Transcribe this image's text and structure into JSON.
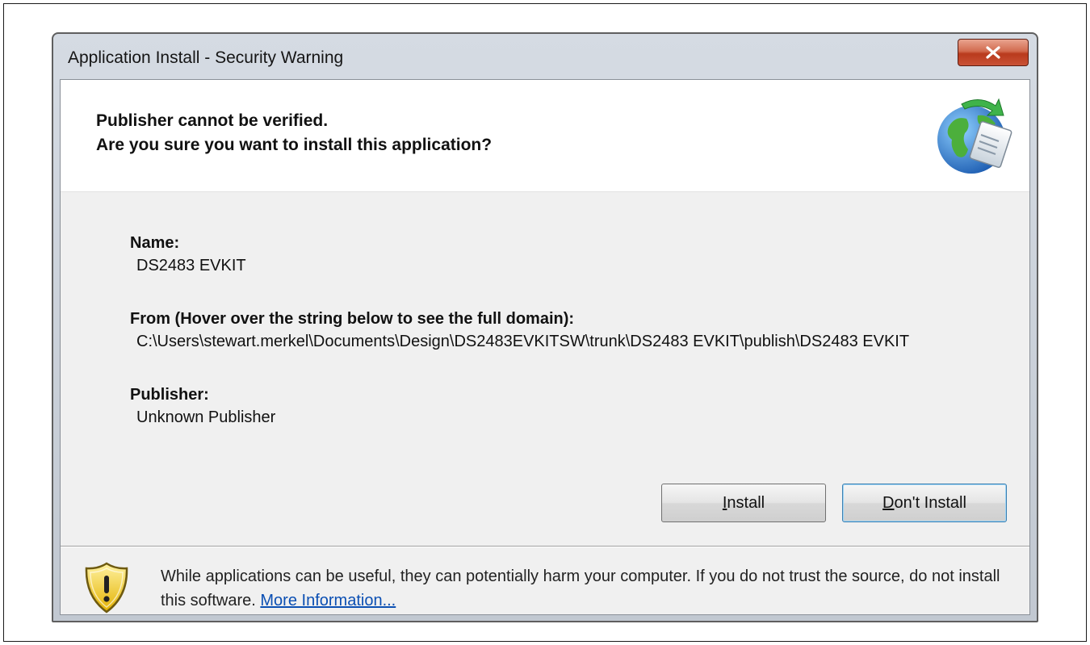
{
  "window": {
    "title": "Application Install - Security Warning"
  },
  "header": {
    "line1": "Publisher cannot be verified.",
    "line2": "Are you sure you want to install this application?",
    "icon": "globe-install-icon"
  },
  "details": {
    "name_label": "Name:",
    "name_value": "DS2483 EVKIT",
    "from_label": "From (Hover over the string below to see the full domain):",
    "from_value": "C:\\Users\\stewart.merkel\\Documents\\Design\\DS2483EVKITSW\\trunk\\DS2483 EVKIT\\publish\\DS2483 EVKIT",
    "publisher_label": "Publisher:",
    "publisher_value": "Unknown Publisher"
  },
  "buttons": {
    "install_mnemonic": "I",
    "install_rest": "nstall",
    "dont_mnemonic": "D",
    "dont_rest": "on't Install"
  },
  "footer": {
    "warning_text": "While applications can be useful, they can potentially harm your computer. If you do not trust the source, do not install this software. ",
    "more_info_link": "More Information...",
    "icon": "shield-warning-icon"
  },
  "colors": {
    "close_button": "#c95236",
    "link": "#0b4fb3",
    "shield": "#f2c81b"
  }
}
